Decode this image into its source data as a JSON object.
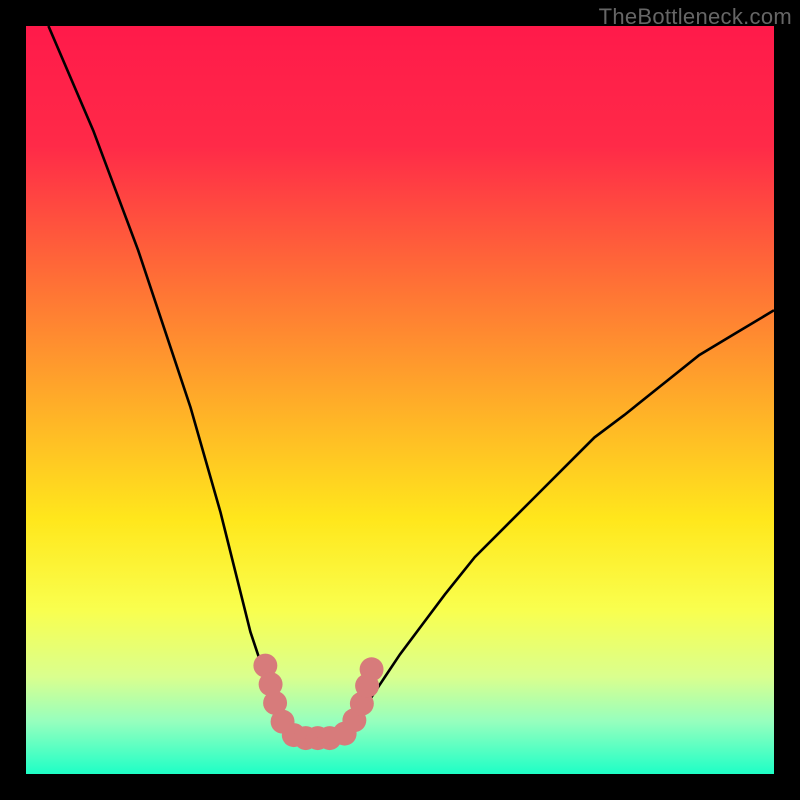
{
  "watermark": {
    "text": "TheBottleneck.com"
  },
  "chart_data": {
    "type": "line",
    "title": "",
    "xlabel": "",
    "ylabel": "",
    "xlim": [
      0,
      100
    ],
    "ylim": [
      0,
      100
    ],
    "grid": false,
    "legend": false,
    "gradient_stops": [
      {
        "pos": 0,
        "color": "#ff1a4a"
      },
      {
        "pos": 16,
        "color": "#ff2a48"
      },
      {
        "pos": 34,
        "color": "#ff6f36"
      },
      {
        "pos": 52,
        "color": "#ffb327"
      },
      {
        "pos": 66,
        "color": "#ffe71c"
      },
      {
        "pos": 78,
        "color": "#f9ff4e"
      },
      {
        "pos": 87,
        "color": "#daff8e"
      },
      {
        "pos": 93,
        "color": "#96ffbe"
      },
      {
        "pos": 100,
        "color": "#1effc6"
      }
    ],
    "series": [
      {
        "name": "left-curve",
        "x": [
          3,
          6,
          9,
          12,
          15,
          18,
          20,
          22,
          24,
          26,
          27,
          28,
          29,
          30,
          31,
          32,
          33,
          34,
          35,
          35.6
        ],
        "y": [
          100,
          93,
          86,
          78,
          70,
          61,
          55,
          49,
          42,
          35,
          31,
          27,
          23,
          19,
          16,
          13,
          10,
          8,
          6,
          5
        ]
      },
      {
        "name": "right-curve",
        "x": [
          42.5,
          44,
          46,
          48,
          50,
          53,
          56,
          60,
          64,
          68,
          72,
          76,
          80,
          85,
          90,
          95,
          100
        ],
        "y": [
          5,
          7,
          10,
          13,
          16,
          20,
          24,
          29,
          33,
          37,
          41,
          45,
          48,
          52,
          56,
          59,
          62
        ]
      },
      {
        "name": "floor",
        "x": [
          35.6,
          42.5
        ],
        "y": [
          4.8,
          4.8
        ]
      }
    ],
    "markers": {
      "color": "#d77b7b",
      "radius": 1.6,
      "points": [
        {
          "x": 32.0,
          "y": 14.5
        },
        {
          "x": 32.7,
          "y": 12.0
        },
        {
          "x": 33.3,
          "y": 9.5
        },
        {
          "x": 34.3,
          "y": 7.0
        },
        {
          "x": 35.8,
          "y": 5.2
        },
        {
          "x": 37.4,
          "y": 4.8
        },
        {
          "x": 39.0,
          "y": 4.8
        },
        {
          "x": 40.6,
          "y": 4.8
        },
        {
          "x": 42.6,
          "y": 5.4
        },
        {
          "x": 43.9,
          "y": 7.2
        },
        {
          "x": 44.9,
          "y": 9.4
        },
        {
          "x": 45.6,
          "y": 11.8
        },
        {
          "x": 46.2,
          "y": 14.0
        }
      ]
    }
  }
}
